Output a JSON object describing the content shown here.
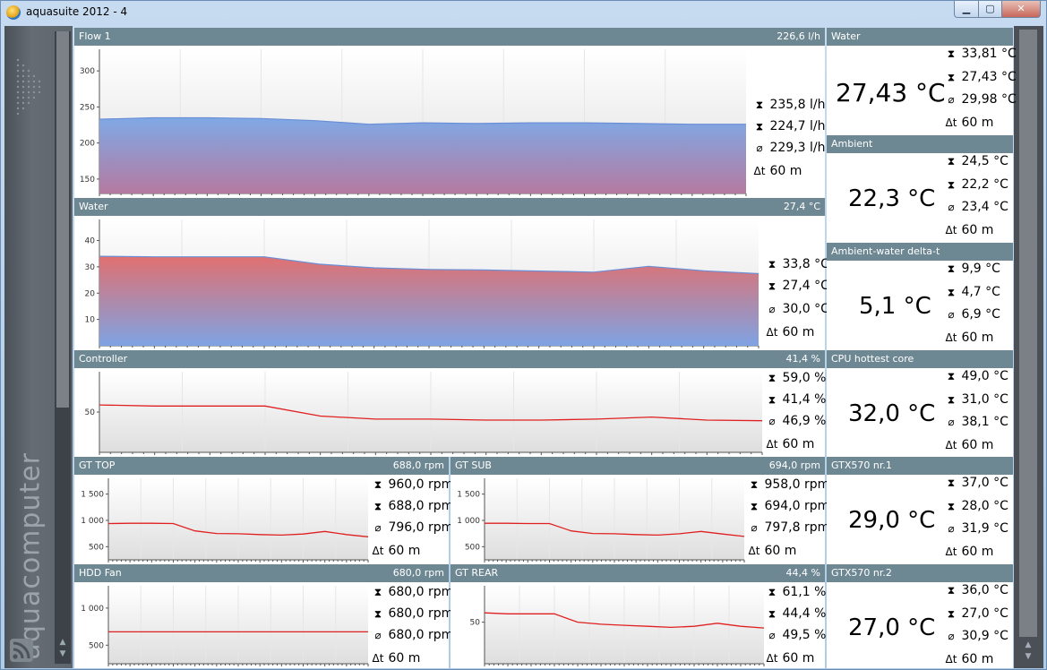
{
  "window": {
    "title": "aquasuite 2012 - 4",
    "minimize": "▁",
    "maximize": "▢",
    "close": "✕"
  },
  "sidebar": {
    "logo_text": "aquacomputer",
    "icons": [
      "chevron-pattern-icon",
      "rss-icon"
    ]
  },
  "charts": [
    {
      "id": "flow1",
      "title": "Flow 1",
      "current": "226,6 l/h",
      "max": "235,8 l/h",
      "min": "224,7 l/h",
      "avg": "229,3 l/h",
      "span": "60 m"
    },
    {
      "id": "water",
      "title": "Water",
      "current": "27,4 °C",
      "max": "33,8 °C",
      "min": "27,4 °C",
      "avg": "30,0 °C",
      "span": "60 m"
    },
    {
      "id": "controller",
      "title": "Controller",
      "current": "41,4 %",
      "max": "59,0 %",
      "min": "41,4 %",
      "avg": "46,9 %",
      "span": "60 m"
    },
    {
      "id": "gttop",
      "title": "GT TOP",
      "current": "688,0 rpm",
      "max": "960,0 rpm",
      "min": "688,0 rpm",
      "avg": "796,0 rpm",
      "span": "60 m"
    },
    {
      "id": "gtsub",
      "title": "GT SUB",
      "current": "694,0 rpm",
      "max": "958,0 rpm",
      "min": "694,0 rpm",
      "avg": "797,8 rpm",
      "span": "60 m"
    },
    {
      "id": "hddfan",
      "title": "HDD Fan",
      "current": "680,0 rpm",
      "max": "680,0 rpm",
      "min": "680,0 rpm",
      "avg": "680,0 rpm",
      "span": "60 m"
    },
    {
      "id": "gtrear",
      "title": "GT REAR",
      "current": "44,4 %",
      "max": "61,1 %",
      "min": "44,4 %",
      "avg": "49,5 %",
      "span": "60 m"
    }
  ],
  "gauges": [
    {
      "id": "g-water",
      "title": "Water",
      "value": "27,43 °C",
      "max": "33,81 °C",
      "min": "27,43 °C",
      "avg": "29,98 °C",
      "span": "60 m"
    },
    {
      "id": "g-ambient",
      "title": "Ambient",
      "value": "22,3 °C",
      "max": "24,5 °C",
      "min": "22,2 °C",
      "avg": "23,4 °C",
      "span": "60 m"
    },
    {
      "id": "g-delta",
      "title": "Ambient-water delta-t",
      "value": "5,1 °C",
      "max": "9,9 °C",
      "min": "4,7 °C",
      "avg": "6,9 °C",
      "span": "60 m"
    },
    {
      "id": "g-cpu",
      "title": "CPU hottest core",
      "value": "32,0 °C",
      "max": "49,0 °C",
      "min": "31,0 °C",
      "avg": "38,1 °C",
      "span": "60 m"
    },
    {
      "id": "g-gtx1",
      "title": "GTX570 nr.1",
      "value": "29,0 °C",
      "max": "37,0 °C",
      "min": "28,0 °C",
      "avg": "31,9 °C",
      "span": "60 m"
    },
    {
      "id": "g-gtx2",
      "title": "GTX570 nr.2",
      "value": "27,0 °C",
      "max": "36,0 °C",
      "min": "27,0 °C",
      "avg": "30,9 °C",
      "span": "60 m"
    }
  ],
  "stat_symbols": {
    "max": "⧗",
    "min": "⧗",
    "avg": "⌀",
    "span": "Δt"
  },
  "colors": {
    "header": "#6e8893",
    "flow_fill_top": "#7fa9e6",
    "water_fill_top": "#e07070",
    "line_red": "#e02020"
  },
  "chart_data": [
    {
      "type": "area",
      "name": "Flow 1",
      "ylim": [
        130,
        330
      ],
      "y_ticks": [
        "300",
        "250",
        "200",
        "150"
      ],
      "y_tick_values": [
        300,
        250,
        200,
        150
      ],
      "x": [
        0,
        5,
        10,
        15,
        20,
        25,
        30,
        35,
        40,
        45,
        50,
        55,
        60
      ],
      "values": [
        233,
        235,
        235,
        234,
        231,
        226,
        228,
        227,
        228,
        228,
        227,
        226,
        226
      ]
    },
    {
      "type": "area",
      "name": "Water",
      "ylim": [
        0,
        48
      ],
      "y_ticks": [
        "40",
        "30",
        "20",
        "10"
      ],
      "y_tick_values": [
        40,
        30,
        20,
        10
      ],
      "x": [
        0,
        5,
        10,
        15,
        20,
        25,
        30,
        35,
        40,
        45,
        50,
        55,
        60
      ],
      "values": [
        34,
        33.8,
        33.8,
        33.8,
        31,
        29.6,
        29,
        28.8,
        28.4,
        28,
        30.2,
        28.5,
        27.4
      ]
    },
    {
      "type": "line",
      "name": "Controller",
      "ylim": [
        10,
        90
      ],
      "y_ticks": [
        "50"
      ],
      "y_tick_values": [
        50
      ],
      "x": [
        0,
        5,
        10,
        15,
        20,
        25,
        30,
        35,
        40,
        45,
        50,
        55,
        60
      ],
      "values": [
        57,
        56,
        56,
        56,
        46,
        43,
        43,
        42,
        42,
        43,
        45,
        42,
        41.4
      ]
    },
    {
      "type": "line",
      "name": "GT TOP",
      "ylim": [
        250,
        1800
      ],
      "y_ticks": [
        "1 500",
        "1 000",
        "500"
      ],
      "y_tick_values": [
        1500,
        1000,
        500
      ],
      "x": [
        0,
        5,
        10,
        15,
        20,
        25,
        30,
        35,
        40,
        45,
        50,
        55,
        60
      ],
      "values": [
        940,
        945,
        945,
        940,
        800,
        750,
        745,
        730,
        720,
        740,
        790,
        730,
        688
      ]
    },
    {
      "type": "line",
      "name": "GT SUB",
      "ylim": [
        250,
        1800
      ],
      "y_ticks": [
        "1 500",
        "1 000",
        "500"
      ],
      "y_tick_values": [
        1500,
        1000,
        500
      ],
      "x": [
        0,
        5,
        10,
        15,
        20,
        25,
        30,
        35,
        40,
        45,
        50,
        55,
        60
      ],
      "values": [
        945,
        945,
        940,
        940,
        800,
        750,
        745,
        730,
        720,
        745,
        790,
        740,
        694
      ]
    },
    {
      "type": "line",
      "name": "HDD Fan",
      "ylim": [
        250,
        1300
      ],
      "y_ticks": [
        "1 000",
        "500"
      ],
      "y_tick_values": [
        1000,
        500
      ],
      "x": [
        0,
        60
      ],
      "values": [
        680,
        680
      ]
    },
    {
      "type": "line",
      "name": "GT REAR",
      "ylim": [
        10,
        85
      ],
      "y_ticks": [
        "50"
      ],
      "y_tick_values": [
        50
      ],
      "x": [
        0,
        5,
        10,
        15,
        20,
        25,
        30,
        35,
        40,
        45,
        50,
        55,
        60
      ],
      "values": [
        59,
        58,
        58,
        58,
        50,
        48,
        47,
        46,
        45,
        46,
        49,
        46,
        44.4
      ]
    }
  ]
}
